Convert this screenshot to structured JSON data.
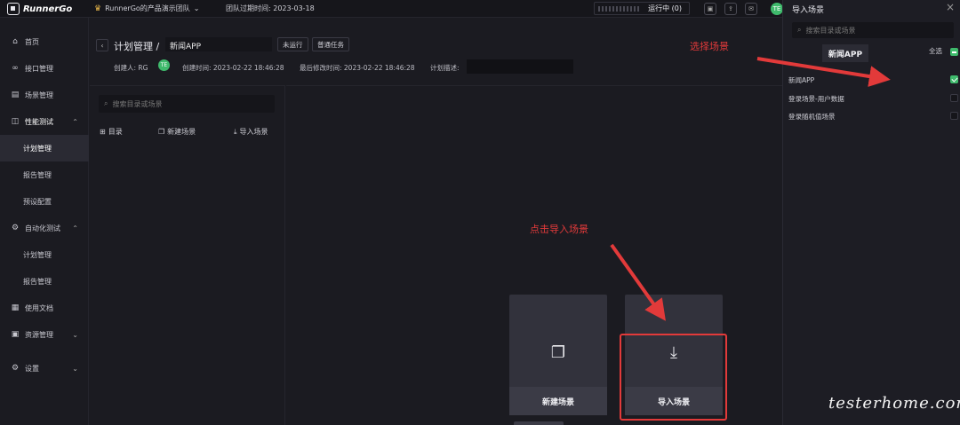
{
  "topbar": {
    "brand": "RunnerGo",
    "team_name": "RunnerGo的产品演示团队",
    "team_expire_label": "团队过期时间: 2023-03-18",
    "running_label": "运行中",
    "running_count": "(0)",
    "user_avatar": "TE"
  },
  "sidebar": {
    "items": [
      {
        "label": "首页",
        "icon": "home-icon"
      },
      {
        "label": "接口管理",
        "icon": "link-icon"
      },
      {
        "label": "场景管理",
        "icon": "scene-icon"
      },
      {
        "label": "性能测试",
        "icon": "chart-icon"
      },
      {
        "label": "计划管理"
      },
      {
        "label": "报告管理"
      },
      {
        "label": "预设配置"
      },
      {
        "label": "自动化测试",
        "icon": "auto-icon"
      },
      {
        "label": "计划管理"
      },
      {
        "label": "报告管理"
      },
      {
        "label": "使用文档",
        "icon": "doc-icon"
      },
      {
        "label": "资源管理",
        "icon": "resource-icon"
      },
      {
        "label": "设置",
        "icon": "gear-icon"
      }
    ]
  },
  "header": {
    "title": "计划管理 /",
    "plan_name": "新闻APP",
    "status_tag": "未运行",
    "type_tag": "普通任务",
    "creator_label": "创建人: RG",
    "creator_avatar": "TE",
    "created_label": "创建时间: 2023-02-22 18:46:28",
    "modified_label": "最后修改时间: 2023-02-22 18:46:28",
    "desc_label": "计划描述:"
  },
  "tree": {
    "search_placeholder": "搜索目录或场景",
    "actions": [
      "目录",
      "新建场景",
      "导入场景"
    ]
  },
  "canvas": {
    "cards": [
      {
        "label": "新建场景",
        "icon": "copy-icon"
      },
      {
        "label": "导入场景",
        "icon": "download-icon"
      }
    ],
    "annotation_click": "点击导入场景",
    "annotation_select": "选择场景"
  },
  "import_panel": {
    "title": "导入场景",
    "search_placeholder": "搜索目录或场景",
    "tab": "新闻APP",
    "select_all": "全选",
    "items": [
      {
        "label": "新闻APP",
        "checked": true
      },
      {
        "label": "登录场景-用户数据",
        "checked": false
      },
      {
        "label": "登录随机值场景",
        "checked": false
      }
    ]
  },
  "watermark": "testerhome.com",
  "colors": {
    "accent_green": "#3fba6c",
    "annotation_red": "#e23a3a",
    "background": "#1b1b21"
  }
}
